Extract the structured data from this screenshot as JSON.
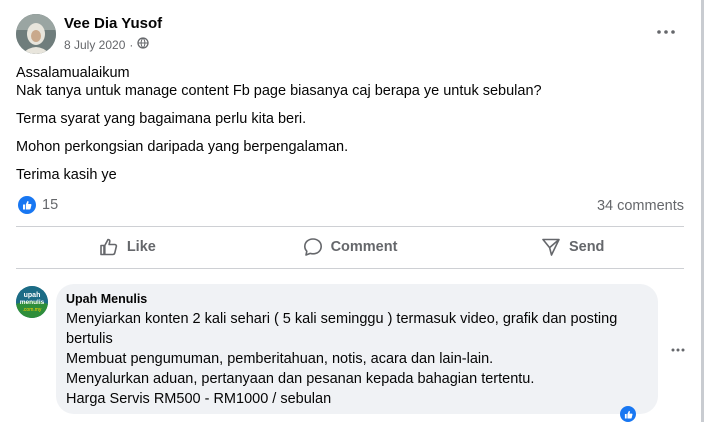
{
  "post": {
    "author": "Vee Dia Yusof",
    "date": "8 July 2020",
    "date_separator": "·",
    "privacy_icon": "globe-icon",
    "more_icon": "more-horizontal-icon",
    "lines": [
      "Assalamualaikum",
      "Nak tanya untuk manage content Fb page biasanya caj berapa ye untuk sebulan?",
      "Terma syarat yang bagaimana perlu kita beri.",
      "Mohon perkongsian daripada yang berpengalaman.",
      "Terima kasih ye"
    ]
  },
  "reactions": {
    "icon": "like-reaction-icon",
    "count": "15",
    "comments": "34 comments"
  },
  "actions": {
    "like": "Like",
    "comment": "Comment",
    "send": "Send"
  },
  "comment": {
    "author": "Upah Menulis",
    "avatar_text_1": "upah",
    "avatar_text_2": "menulis",
    "avatar_text_3": ".com.my",
    "lines": [
      "Menyiarkan konten 2 kali sehari ( 5 kali seminggu ) termasuk video, grafik dan posting bertulis",
      "Membuat pengumuman, pemberitahuan, notis, acara dan lain-lain.",
      "Menyalurkan aduan, pertanyaan dan pesanan kepada bahagian tertentu.",
      "Harga Servis RM500 - RM1000 / sebulan"
    ]
  },
  "colors": {
    "accent": "#1877f2",
    "secondary_text": "#65676b",
    "bubble": "#f0f2f5"
  }
}
